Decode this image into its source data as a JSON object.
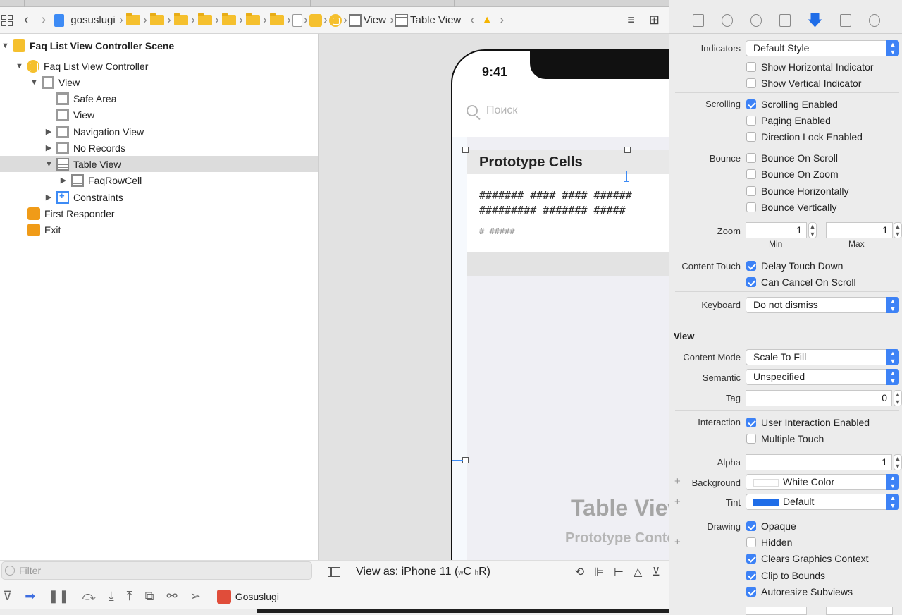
{
  "jumpbar": {
    "project": "gosuslugi",
    "view_crumb": "View",
    "table_crumb": "Table View"
  },
  "outline": {
    "items": [
      {
        "label": "Faq List View Controller Scene"
      },
      {
        "label": "Faq List View Controller"
      },
      {
        "label": "View"
      },
      {
        "label": "Safe Area"
      },
      {
        "label": "View"
      },
      {
        "label": "Navigation View"
      },
      {
        "label": "No Records"
      },
      {
        "label": "Table View"
      },
      {
        "label": "FaqRowCell"
      },
      {
        "label": "Constraints"
      },
      {
        "label": "First Responder"
      },
      {
        "label": "Exit"
      }
    ],
    "filter_placeholder": "Filter"
  },
  "canvas": {
    "time": "9:41",
    "search_placeholder": "Поиск",
    "prototype_header": "Prototype Cells",
    "cell_line1": "####### #### #### ######",
    "cell_line2": "######### ####### #####",
    "cell_subtitle": "# #####",
    "watermark_title": "Table View",
    "watermark_subtitle": "Prototype Content",
    "view_as": "View as: iPhone 11 (",
    "view_as_w": "w",
    "view_as_c": "C ",
    "view_as_h": "h",
    "view_as_r": "R)"
  },
  "debugbar": {
    "app_name": "Gosuslugi"
  },
  "inspector": {
    "indicators_label": "Indicators",
    "indicators_value": "Default Style",
    "show_horizontal": "Show Horizontal Indicator",
    "show_vertical": "Show Vertical Indicator",
    "scrolling_label": "Scrolling",
    "scrolling_enabled": "Scrolling Enabled",
    "paging_enabled": "Paging Enabled",
    "direction_lock": "Direction Lock Enabled",
    "bounce_label": "Bounce",
    "bounce_on_scroll": "Bounce On Scroll",
    "bounce_on_zoom": "Bounce On Zoom",
    "bounce_horizontally": "Bounce Horizontally",
    "bounce_vertically": "Bounce Vertically",
    "zoom_label": "Zoom",
    "zoom_min": "1",
    "zoom_max": "1",
    "min_label": "Min",
    "max_label": "Max",
    "content_touch_label": "Content Touch",
    "delay_touch_down": "Delay Touch Down",
    "can_cancel_on_scroll": "Can Cancel On Scroll",
    "keyboard_label": "Keyboard",
    "keyboard_value": "Do not dismiss",
    "view_section": "View",
    "content_mode_label": "Content Mode",
    "content_mode_value": "Scale To Fill",
    "semantic_label": "Semantic",
    "semantic_value": "Unspecified",
    "tag_label": "Tag",
    "tag_value": "0",
    "interaction_label": "Interaction",
    "user_interaction": "User Interaction Enabled",
    "multiple_touch": "Multiple Touch",
    "alpha_label": "Alpha",
    "alpha_value": "1",
    "background_label": "Background",
    "background_value": "White Color",
    "tint_label": "Tint",
    "tint_value": "Default",
    "drawing_label": "Drawing",
    "opaque": "Opaque",
    "hidden": "Hidden",
    "clears_graphics": "Clears Graphics Context",
    "clip_to_bounds": "Clip to Bounds",
    "autoresize_subviews": "Autoresize Subviews",
    "accent_color": "#3d82f6",
    "tint_color": "#1f6de8"
  }
}
